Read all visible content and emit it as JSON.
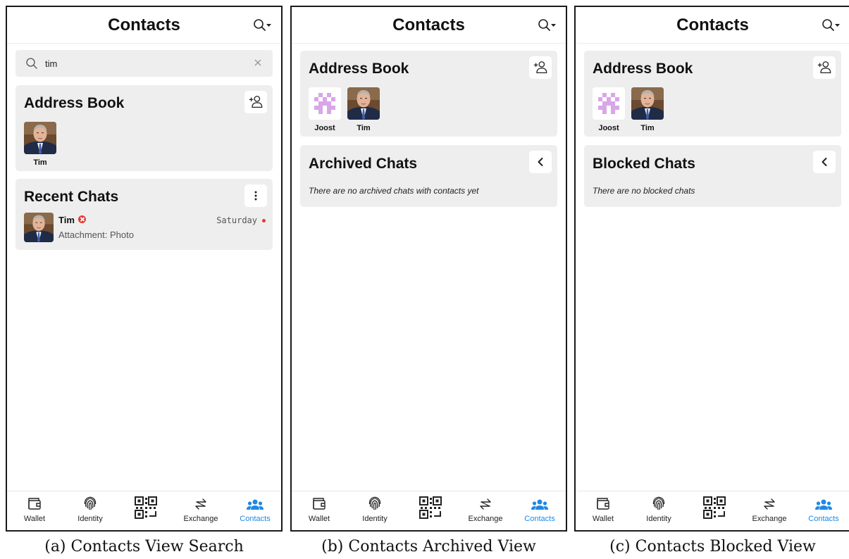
{
  "screens": [
    {
      "id": "a",
      "header_title": "Contacts",
      "search_query": "tim",
      "address_book": {
        "title": "Address Book",
        "contacts": [
          {
            "name": "Tim"
          }
        ]
      },
      "section": {
        "title": "Recent Chats",
        "chats": [
          {
            "name": "Tim",
            "subtitle": "Attachment: Photo",
            "time": "Saturday",
            "error": true,
            "unread": true
          }
        ]
      },
      "caption": "(a) Contacts View Search"
    },
    {
      "id": "b",
      "header_title": "Contacts",
      "address_book": {
        "title": "Address Book",
        "contacts": [
          {
            "name": "Joost"
          },
          {
            "name": "Tim"
          }
        ]
      },
      "section": {
        "title": "Archived Chats",
        "empty_text": "There are no archived chats with contacts yet"
      },
      "caption": "(b) Contacts Archived View"
    },
    {
      "id": "c",
      "header_title": "Contacts",
      "address_book": {
        "title": "Address Book",
        "contacts": [
          {
            "name": "Joost"
          },
          {
            "name": "Tim"
          }
        ]
      },
      "section": {
        "title": "Blocked Chats",
        "empty_text": "There are no blocked chats"
      },
      "caption": "(c) Contacts Blocked View"
    }
  ],
  "nav": [
    {
      "label": "Wallet",
      "icon": "wallet-icon"
    },
    {
      "label": "Identity",
      "icon": "fingerprint-icon"
    },
    {
      "label": "",
      "icon": "qr-code-icon"
    },
    {
      "label": "Exchange",
      "icon": "exchange-icon"
    },
    {
      "label": "Contacts",
      "icon": "contacts-icon",
      "active": true
    }
  ],
  "colors": {
    "accent": "#1e88e5",
    "card_bg": "#eeeeee",
    "error": "#e53935",
    "identicon": "#d9a6e8"
  }
}
